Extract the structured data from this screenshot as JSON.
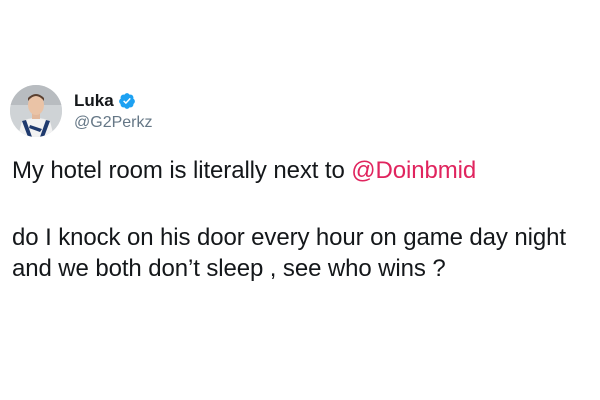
{
  "user": {
    "display_name": "Luka",
    "handle": "@G2Perkz",
    "verified": true,
    "avatar_icon": "user-avatar-photo"
  },
  "tweet": {
    "paragraph1_prefix": "My hotel room is literally next to ",
    "paragraph1_mention": "@Doinbmid",
    "paragraph2": "do I knock on his door every hour on game day night and we both don’t sleep , see who wins ?"
  },
  "colors": {
    "text": "#14171a",
    "handle": "#657786",
    "mention": "#e0245e",
    "verified_badge": "#1da1f2"
  }
}
